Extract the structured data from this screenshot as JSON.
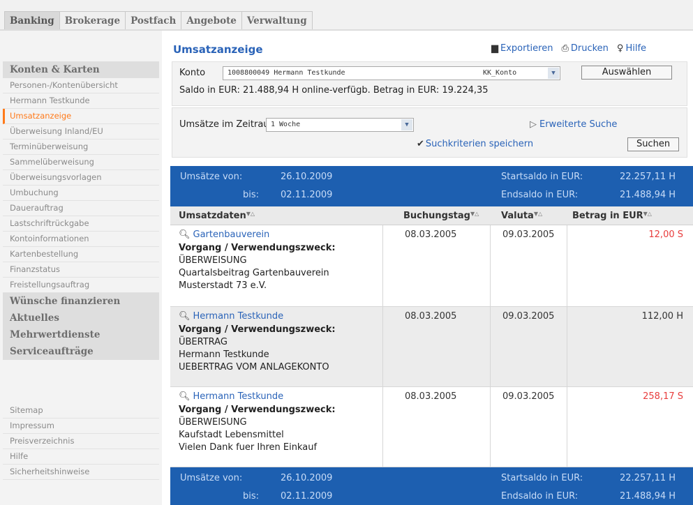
{
  "tabs": [
    "Banking",
    "Brokerage",
    "Postfach",
    "Angebote",
    "Verwaltung"
  ],
  "sidebar": {
    "section1": "Konten & Karten",
    "items": [
      "Personen-/Kontenübersicht",
      "Hermann Testkunde",
      "Umsatzanzeige",
      "Überweisung Inland/EU",
      "Terminüberweisung",
      "Sammelüberweisung",
      "Überweisungsvorlagen",
      "Umbuchung",
      "Dauerauftrag",
      "Lastschriftrückgabe",
      "Kontoinformationen",
      "Kartenbestellung",
      "Finanzstatus",
      "Freistellungsauftrag"
    ],
    "sections": [
      "Wünsche finanzieren",
      "Aktuelles",
      "Mehrwertdienste",
      "Serviceaufträge"
    ],
    "footer": [
      "Sitemap",
      "Impressum",
      "Preisverzeichnis",
      "Hilfe",
      "Sicherheitshinweise"
    ]
  },
  "main": {
    "title": "Umsatzanzeige",
    "toolbar": {
      "export": "Exportieren",
      "print": "Drucken",
      "help": "Hilfe"
    },
    "konto": {
      "label": "Konto",
      "select_value": "1008800049  Hermann Testkunde",
      "select_type": "KK_Konto",
      "button": "Auswählen",
      "saldo": "Saldo in EUR:  21.488,94 H    online-verfügb. Betrag in EUR:  19.224,35"
    },
    "zeitraum": {
      "label": "Umsätze im Zeitraum:",
      "value": "1 Woche",
      "extended": "Erweiterte Suche",
      "save": "Suchkriterien speichern",
      "button": "Suchen"
    },
    "range": {
      "von_label": "Umsätze von:",
      "von_date": "26.10.2009",
      "bis_label": "bis:",
      "bis_date": "02.11.2009",
      "start_label": "Startsaldo in EUR:",
      "start_value": "22.257,11 H",
      "end_label": "Endsaldo in EUR:",
      "end_value": "21.488,94 H"
    },
    "table": {
      "headers": [
        "Umsatzdaten",
        "Buchungstag",
        "Valuta",
        "Betrag in EUR"
      ],
      "sort_icon": "▼△",
      "vorgang_label": "Vorgang / Verwendungszweck:",
      "rows": [
        {
          "payee": "Gartenbauverein",
          "lines": [
            "ÜBERWEISUNG",
            "Quartalsbeitrag Gartenbauverein",
            "Musterstadt 73 e.V."
          ],
          "buchungstag": "08.03.2005",
          "valuta": "09.03.2005",
          "amount": "12,00 S",
          "amount_color": "red"
        },
        {
          "payee": "Hermann Testkunde",
          "lines": [
            "ÜBERTRAG",
            "Hermann Testkunde",
            "UEBERTRAG VOM ANLAGEKONTO"
          ],
          "buchungstag": "08.03.2005",
          "valuta": "09.03.2005",
          "amount": "112,00 H",
          "amount_color": "black"
        },
        {
          "payee": "Hermann Testkunde",
          "lines": [
            "ÜBERWEISUNG",
            "Kaufstadt Lebensmittel",
            "Vielen Dank fuer Ihren Einkauf"
          ],
          "buchungstag": "08.03.2005",
          "valuta": "09.03.2005",
          "amount": "258,17 S",
          "amount_color": "red"
        }
      ]
    }
  }
}
